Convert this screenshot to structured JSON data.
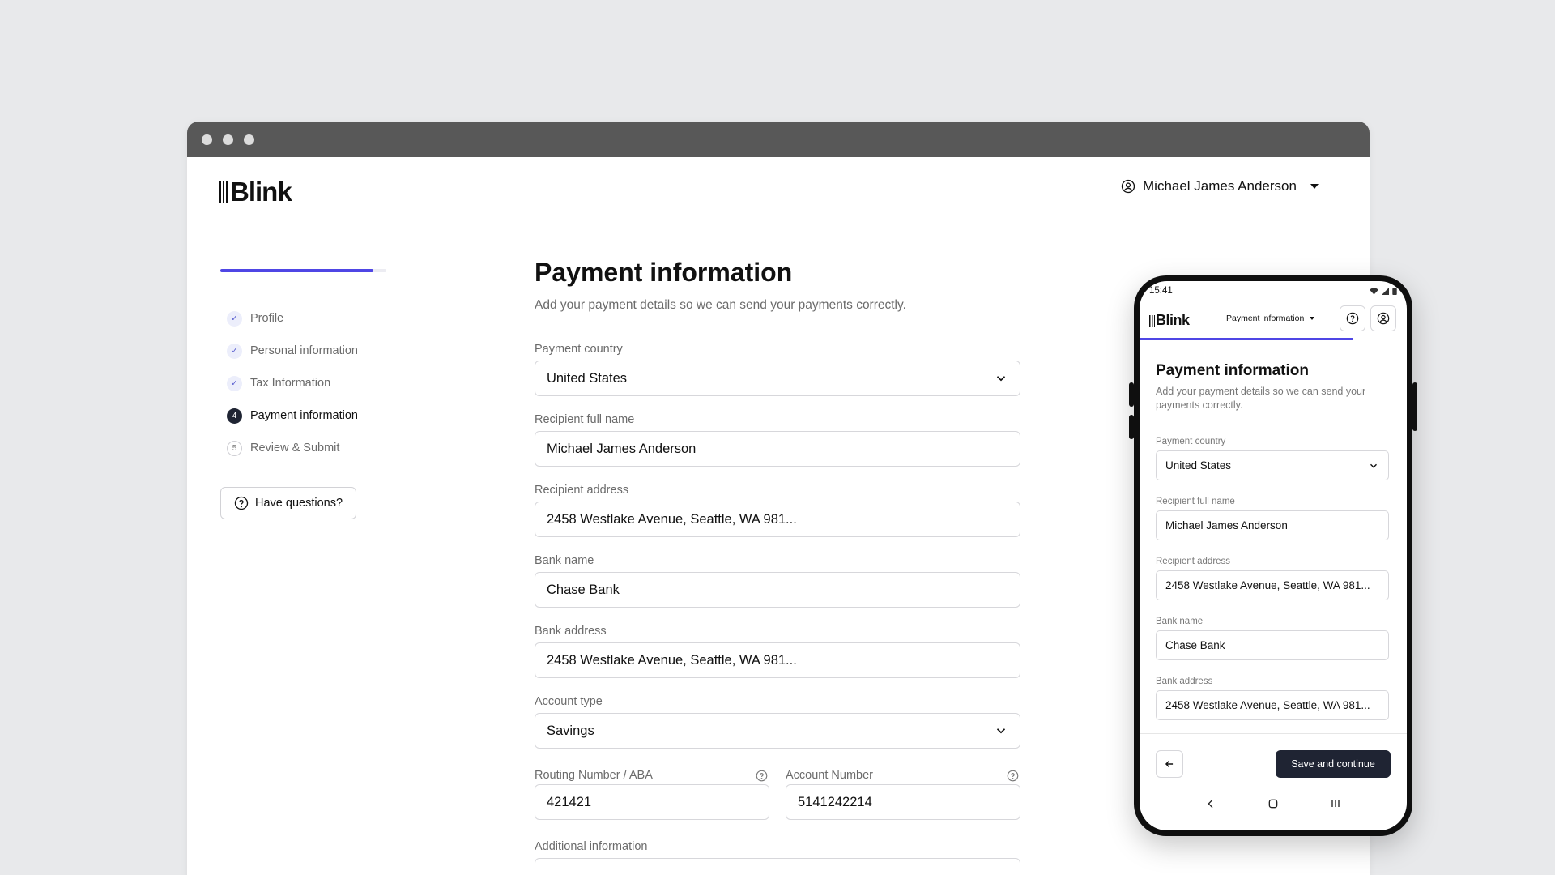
{
  "window": {
    "controls": [
      "close",
      "minimize",
      "maximize"
    ]
  },
  "header": {
    "logo": "Blink",
    "user_name": "Michael James Anderson",
    "icons": {
      "user": "user-circle-icon",
      "dropdown": "caret-down-icon"
    }
  },
  "sidebar": {
    "progress": 0.92,
    "steps": [
      {
        "label": "Profile",
        "status": "done",
        "marker": "✓"
      },
      {
        "label": "Personal information",
        "status": "done",
        "marker": "✓"
      },
      {
        "label": "Tax Information",
        "status": "done",
        "marker": "✓"
      },
      {
        "label": "Payment information",
        "status": "current",
        "marker": "4"
      },
      {
        "label": "Review & Submit",
        "status": "todo",
        "marker": "5"
      }
    ],
    "help_label": "Have questions?"
  },
  "form": {
    "title": "Payment information",
    "subtitle": "Add your payment details so we can send your payments correctly.",
    "payment_country": {
      "label": "Payment country",
      "value": "United States"
    },
    "recipient_name": {
      "label": "Recipient full name",
      "value": "Michael James Anderson"
    },
    "recipient_address": {
      "label": "Recipient address",
      "value": "2458 Westlake Avenue, Seattle, WA 981..."
    },
    "bank_name": {
      "label": "Bank name",
      "value": "Chase Bank"
    },
    "bank_address": {
      "label": "Bank address",
      "value": "2458 Westlake Avenue, Seattle, WA 981..."
    },
    "account_type": {
      "label": "Account type",
      "value": "Savings"
    },
    "routing_number": {
      "label": "Routing Number / ABA",
      "value": "421421"
    },
    "account_number": {
      "label": "Account Number",
      "value": "5141242214"
    },
    "additional_info": {
      "label": "Additional information",
      "value": ""
    }
  },
  "mobile": {
    "time": "15:41",
    "logo": "Blink",
    "step_dropdown": "Payment information",
    "progress": 0.8,
    "title": "Payment information",
    "subtitle": "Add your payment details so we can send your payments correctly.",
    "fields": [
      {
        "label": "Payment country",
        "value": "United States",
        "select": true
      },
      {
        "label": "Recipient full name",
        "value": "Michael James Anderson",
        "select": false
      },
      {
        "label": "Recipient address",
        "value": "2458 Westlake Avenue, Seattle, WA 981...",
        "select": false
      },
      {
        "label": "Bank name",
        "value": "Chase Bank",
        "select": false
      },
      {
        "label": "Bank address",
        "value": "2458 Westlake Avenue, Seattle, WA 981...",
        "select": false
      }
    ],
    "save_label": "Save and continue",
    "accent": "#4f46e5",
    "button_color": "#1f2433"
  }
}
